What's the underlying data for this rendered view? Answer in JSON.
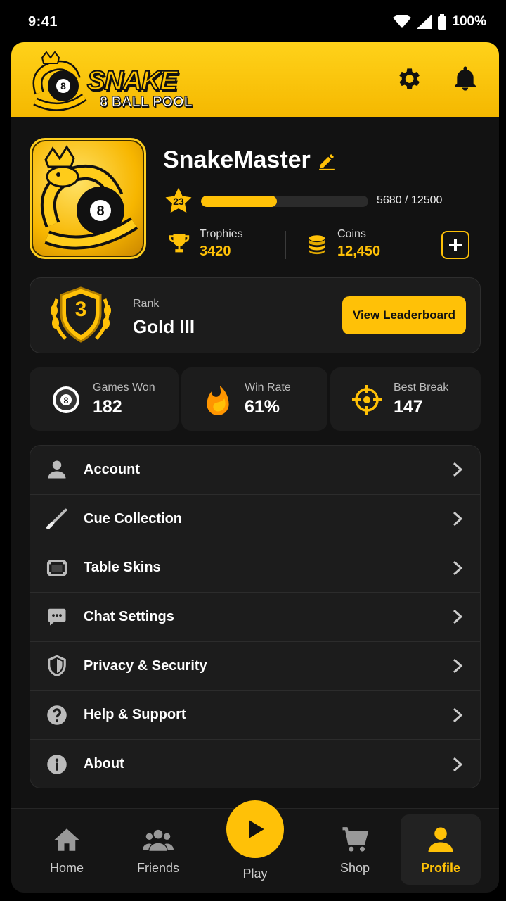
{
  "status": {
    "time": "9:41",
    "battery": "100%"
  },
  "header": {
    "logo_line1": "SNAKE",
    "logo_line2": "8 BALL POOL",
    "settings_icon": "gear-icon",
    "notifications_icon": "bell-icon"
  },
  "profile": {
    "username": "SnakeMaster",
    "level": "23",
    "xp_text": "5680 / 12500",
    "xp_fraction": 0.454,
    "trophies_label": "Trophies",
    "trophies_value": "3420",
    "coins_label": "Coins",
    "coins_value": "12,450"
  },
  "rank": {
    "badge_number": "3",
    "label": "Rank",
    "value": "Gold III",
    "button": "View Leaderboard"
  },
  "quick_stats": [
    {
      "label": "Games Won",
      "value": "182",
      "icon": "eight-ball-icon"
    },
    {
      "label": "Win Rate",
      "value": "61%",
      "icon": "flame-icon"
    },
    {
      "label": "Best Break",
      "value": "147",
      "icon": "crosshair-icon"
    }
  ],
  "menu": [
    {
      "label": "Account",
      "icon": "user-icon"
    },
    {
      "label": "Cue Collection",
      "icon": "cue-icon"
    },
    {
      "label": "Table Skins",
      "icon": "table-icon"
    },
    {
      "label": "Chat Settings",
      "icon": "chat-icon"
    },
    {
      "label": "Privacy & Security",
      "icon": "shield-icon"
    },
    {
      "label": "Help & Support",
      "icon": "help-icon"
    },
    {
      "label": "About",
      "icon": "info-icon"
    }
  ],
  "nav": {
    "home": "Home",
    "friends": "Friends",
    "play": "Play",
    "shop": "Shop",
    "profile": "Profile"
  },
  "colors": {
    "accent": "#ffc107",
    "background": "#121212",
    "card": "#1c1c1c"
  }
}
